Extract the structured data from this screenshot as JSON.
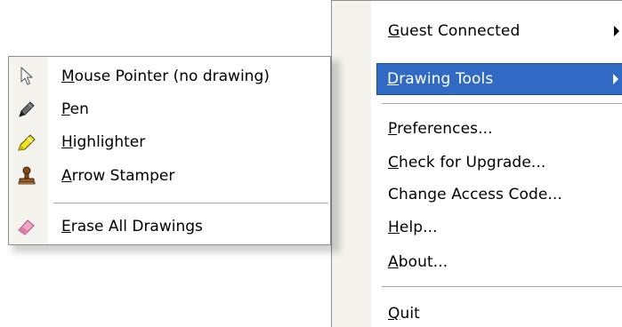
{
  "main_menu": {
    "items": [
      {
        "mnemonic": "G",
        "rest": "uest Connected",
        "has_submenu": true,
        "highlighted": false
      },
      {
        "mnemonic": "D",
        "rest": "rawing Tools",
        "has_submenu": true,
        "highlighted": true
      },
      {
        "mnemonic": "P",
        "rest": "references...",
        "has_submenu": false,
        "highlighted": false
      },
      {
        "mnemonic": "C",
        "rest": "heck for Upgrade...",
        "has_submenu": false,
        "highlighted": false
      },
      {
        "prefix": "Change Access Code...",
        "has_submenu": false,
        "highlighted": false
      },
      {
        "mnemonic": "H",
        "rest": "elp...",
        "has_submenu": false,
        "highlighted": false
      },
      {
        "mnemonic": "A",
        "rest": "bout...",
        "has_submenu": false,
        "highlighted": false
      },
      {
        "mnemonic": "Q",
        "rest": "uit",
        "has_submenu": false,
        "highlighted": false
      }
    ]
  },
  "drawing_tools_menu": {
    "items": [
      {
        "icon": "mouse-pointer-icon",
        "mnemonic": "M",
        "rest": "ouse Pointer (no drawing)"
      },
      {
        "icon": "pen-icon",
        "mnemonic": "P",
        "rest": "en"
      },
      {
        "icon": "highlighter-icon",
        "mnemonic": "H",
        "rest": "ighlighter"
      },
      {
        "icon": "stamp-icon",
        "mnemonic": "A",
        "rest": "rrow Stamper"
      },
      {
        "icon": "eraser-icon",
        "mnemonic": "E",
        "rest": "rase All Drawings"
      }
    ]
  },
  "colors": {
    "highlight": "#316ac5",
    "gutter": "#f4f3ee",
    "separator": "#a7a6aa"
  }
}
